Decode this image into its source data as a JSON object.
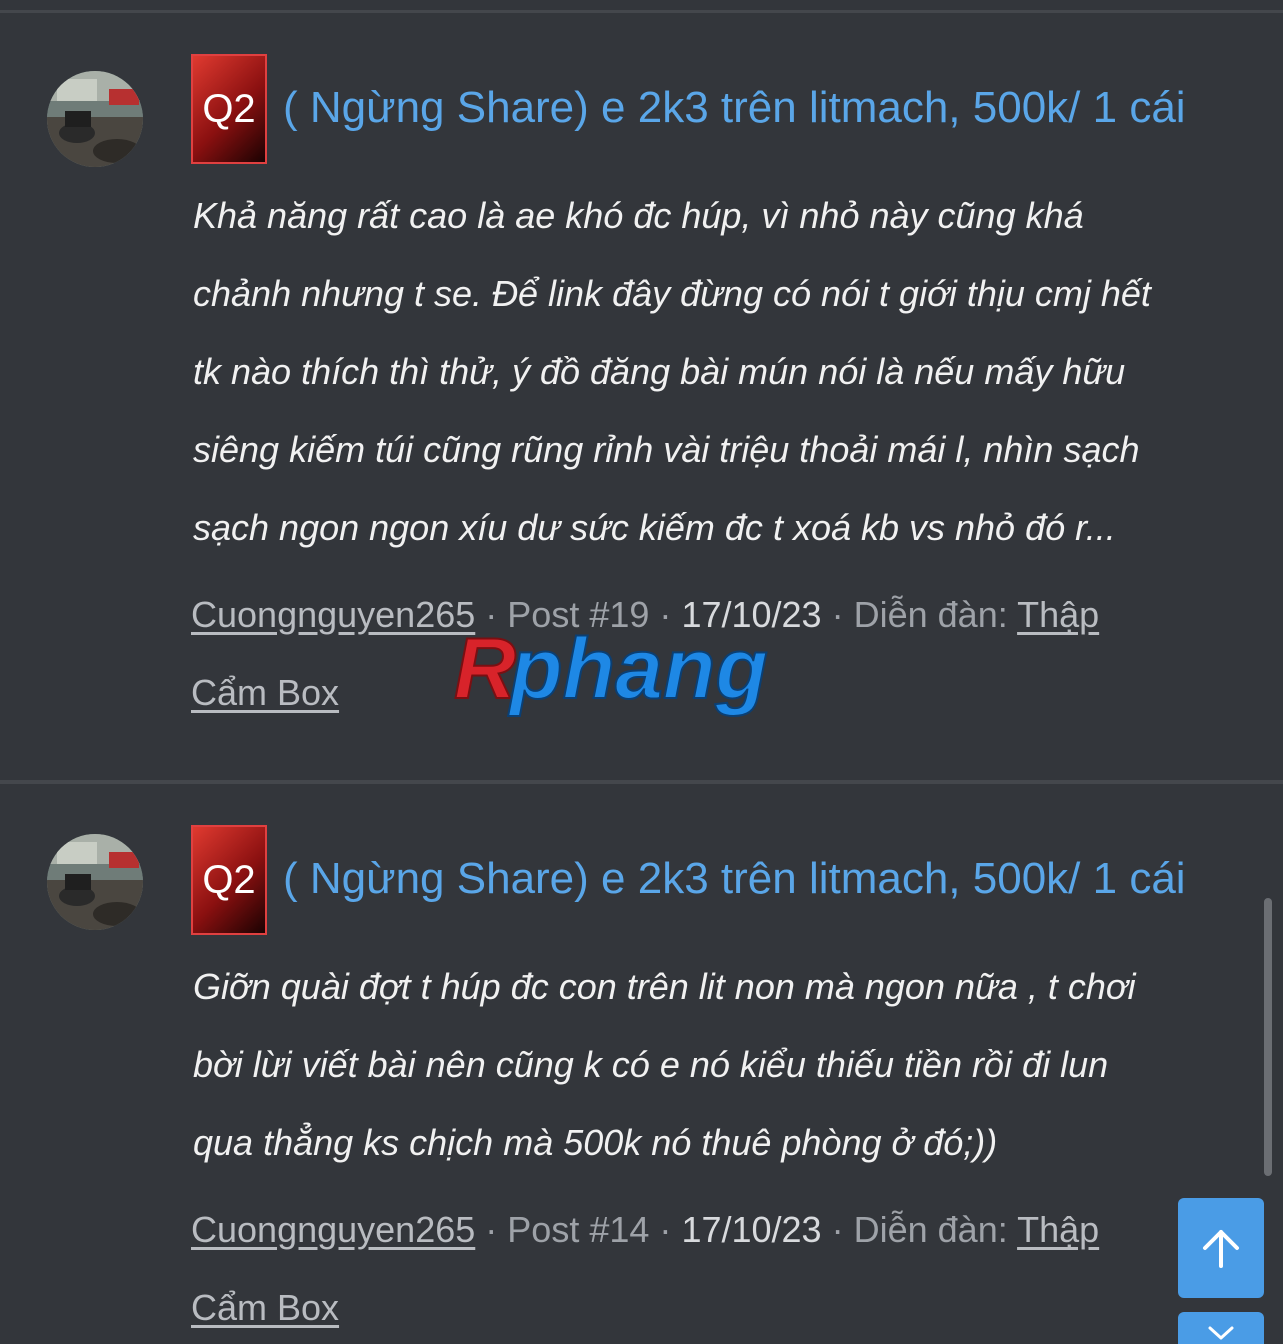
{
  "results": [
    {
      "prefix": "Q2",
      "title": "( Ngừng Share) e 2k3 trên litmach, 500k/ 1 cái",
      "snippet_lines": [
        "Khả năng rất cao là ae khó đc húp, vì nhỏ này cũng khá",
        "chảnh nhưng t se. Để link đây đừng có nói t giới thịu cmj hết",
        "tk nào thích thì thử, ý đồ đăng bài mún nói là nếu mấy hữu",
        "siêng kiếm túi cũng rũng rỉnh vài triệu thoải mái l, nhìn sạch",
        "sạch ngon ngon xíu dư sức kiếm đc t xoá kb vs nhỏ đó r..."
      ],
      "author": "Cuongnguyen265",
      "post": "Post #19",
      "date": "17/10/23",
      "forum_label": "Diễn đàn:",
      "forum_part1": "Thập",
      "forum_part2": "Cẩm Box"
    },
    {
      "prefix": "Q2",
      "title": "( Ngừng Share) e 2k3 trên litmach, 500k/ 1 cái",
      "snippet_lines": [
        "Giỡn quài đợt t húp đc con trên lit non mà ngon nữa , t chơi",
        "bời lừi viết bài nên cũng k có e nó kiểu thiếu tiền rồi đi lun",
        "qua thẳng ks chịch mà 500k nó thuê phòng ở đó;))"
      ],
      "author": "Cuongnguyen265",
      "post": "Post #14",
      "date": "17/10/23",
      "forum_label": "Diễn đàn:",
      "forum_part1": "Thập",
      "forum_part2": "Cẩm Box"
    }
  ],
  "separator": "·",
  "watermark": "Rphang",
  "colors": {
    "background": "#33363b",
    "title_link": "#5aa6e8",
    "prefix_badge": "#c0201a",
    "fab": "#4a9ce6",
    "watermark_red": "#d8232a",
    "watermark_blue": "#1e88e5"
  },
  "icons": {
    "scroll_top": "arrow-up-icon",
    "scroll_bottom": "arrow-down-icon"
  }
}
